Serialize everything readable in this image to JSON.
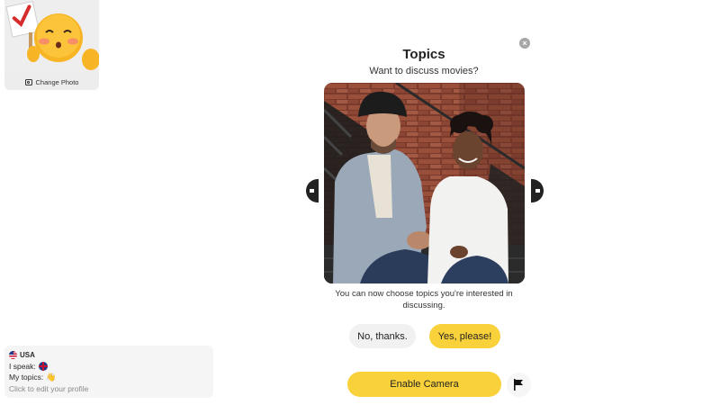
{
  "avatar": {
    "change_photo_label": "Change Photo"
  },
  "profile": {
    "country": "USA",
    "speaks_label": "I speak:",
    "topics_label": "My topics:",
    "edit_hint": "Click to edit your profile"
  },
  "modal": {
    "title": "Topics",
    "subtitle": "Want to discuss movies?",
    "description": "You can now choose topics you're interested in discussing.",
    "no_button": "No, thanks.",
    "yes_button": "Yes, please!",
    "close_icon": "×"
  },
  "footer": {
    "enable_camera": "Enable Camera"
  },
  "colors": {
    "accent_yellow": "#f9d13a",
    "neutral_button": "#f1f1f1"
  }
}
